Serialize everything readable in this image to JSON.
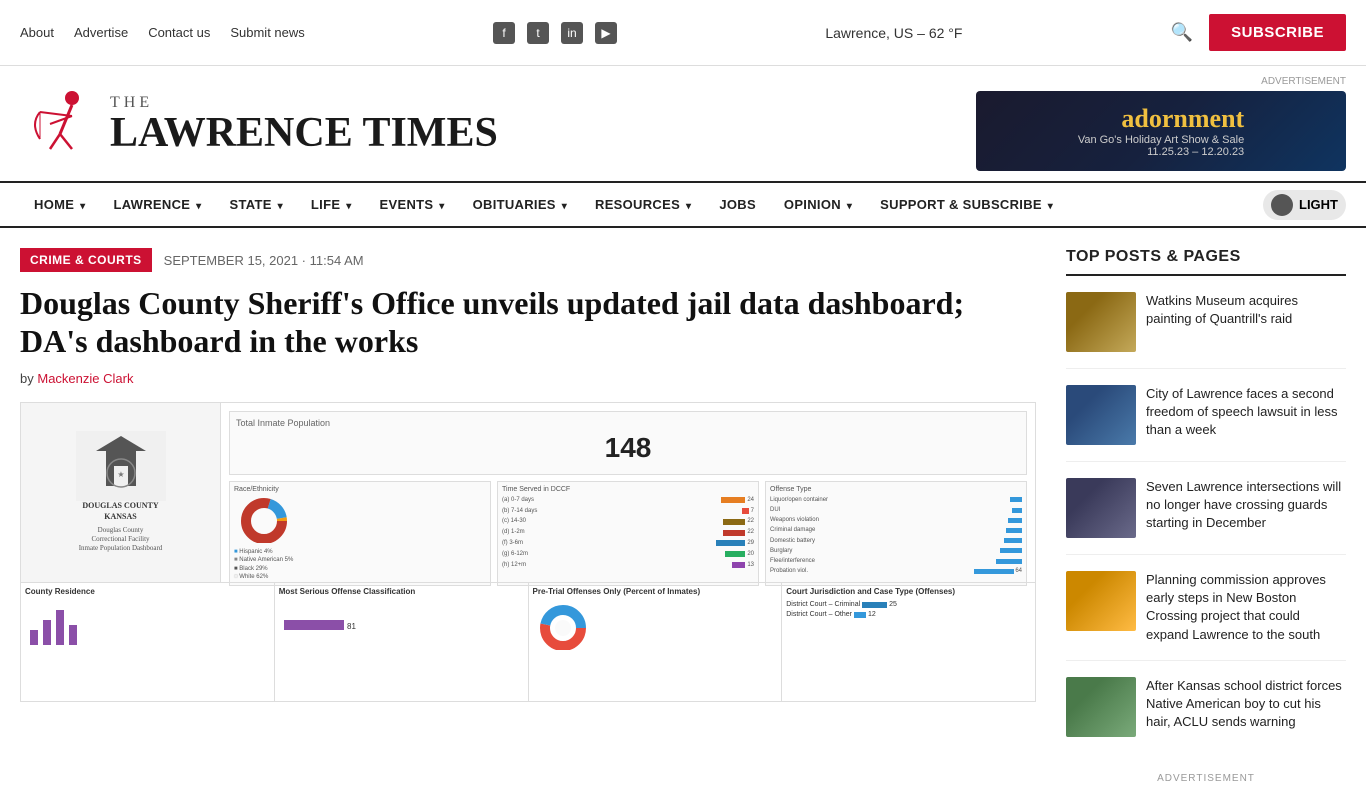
{
  "topbar": {
    "links": [
      "About",
      "Advertise",
      "Contact us",
      "Submit news"
    ],
    "social": [
      "f",
      "t",
      "in",
      "yt"
    ],
    "weather": "Lawrence, US – 62 °F",
    "subscribe_label": "SUBSCRIBE"
  },
  "header": {
    "logo_the": "THE",
    "logo_name": "LAWRENCE TIMES",
    "ad_label": "ADVERTISEMENT",
    "ad_title": "adornment",
    "ad_sub": "Van Go's Holiday Art Show & Sale",
    "ad_dates": "11.25.23 – 12.20.23"
  },
  "nav": {
    "items": [
      {
        "label": "HOME",
        "chevron": true
      },
      {
        "label": "LAWRENCE",
        "chevron": true
      },
      {
        "label": "STATE",
        "chevron": true
      },
      {
        "label": "LIFE",
        "chevron": true
      },
      {
        "label": "EVENTS",
        "chevron": true
      },
      {
        "label": "OBITUARIES",
        "chevron": true
      },
      {
        "label": "RESOURCES",
        "chevron": true
      },
      {
        "label": "JOBS",
        "chevron": false
      },
      {
        "label": "OPINION",
        "chevron": true
      },
      {
        "label": "SUPPORT & SUBSCRIBE",
        "chevron": true
      }
    ],
    "theme_label": "LIGHT"
  },
  "article": {
    "category": "CRIME & COURTS",
    "date": "SEPTEMBER 15, 2021 · 11:54 AM",
    "title": "Douglas County Sheriff's Office unveils updated jail data dashboard; DA's dashboard in the works",
    "byline_prefix": "by",
    "author": "Mackenzie Clark",
    "dashboard_stat_label": "Total Inmate Population",
    "dashboard_stat_number": "148",
    "dashboard_caption_line1": "Douglas County",
    "dashboard_caption_line2": "Correctional Facility",
    "dashboard_caption_line3": "Inmate Population Dashboard",
    "dashboard_section1": "County Residence",
    "dashboard_section2": "Most Serious Offense Classification",
    "dashboard_section3": "Pre-Trial Offenses Only (Percent of Inmates)",
    "dashboard_section4": "Court Jurisdiction and Case Type (Offenses)"
  },
  "sidebar": {
    "title": "TOP POSTS & PAGES",
    "posts": [
      {
        "text": "Watkins Museum acquires painting of Quantrill's raid",
        "img_class": "img-placeholder-1"
      },
      {
        "text": "City of Lawrence faces a second freedom of speech lawsuit in less than a week",
        "img_class": "img-placeholder-2"
      },
      {
        "text": "Seven Lawrence intersections will no longer have crossing guards starting in December",
        "img_class": "img-placeholder-3"
      },
      {
        "text": "Planning commission approves early steps in New Boston Crossing project that could expand Lawrence to the south",
        "img_class": "img-placeholder-4"
      },
      {
        "text": "After Kansas school district forces Native American boy to cut his hair, ACLU sends warning",
        "img_class": "img-placeholder-5"
      }
    ],
    "ad_label": "ADVERTISEMENT"
  }
}
